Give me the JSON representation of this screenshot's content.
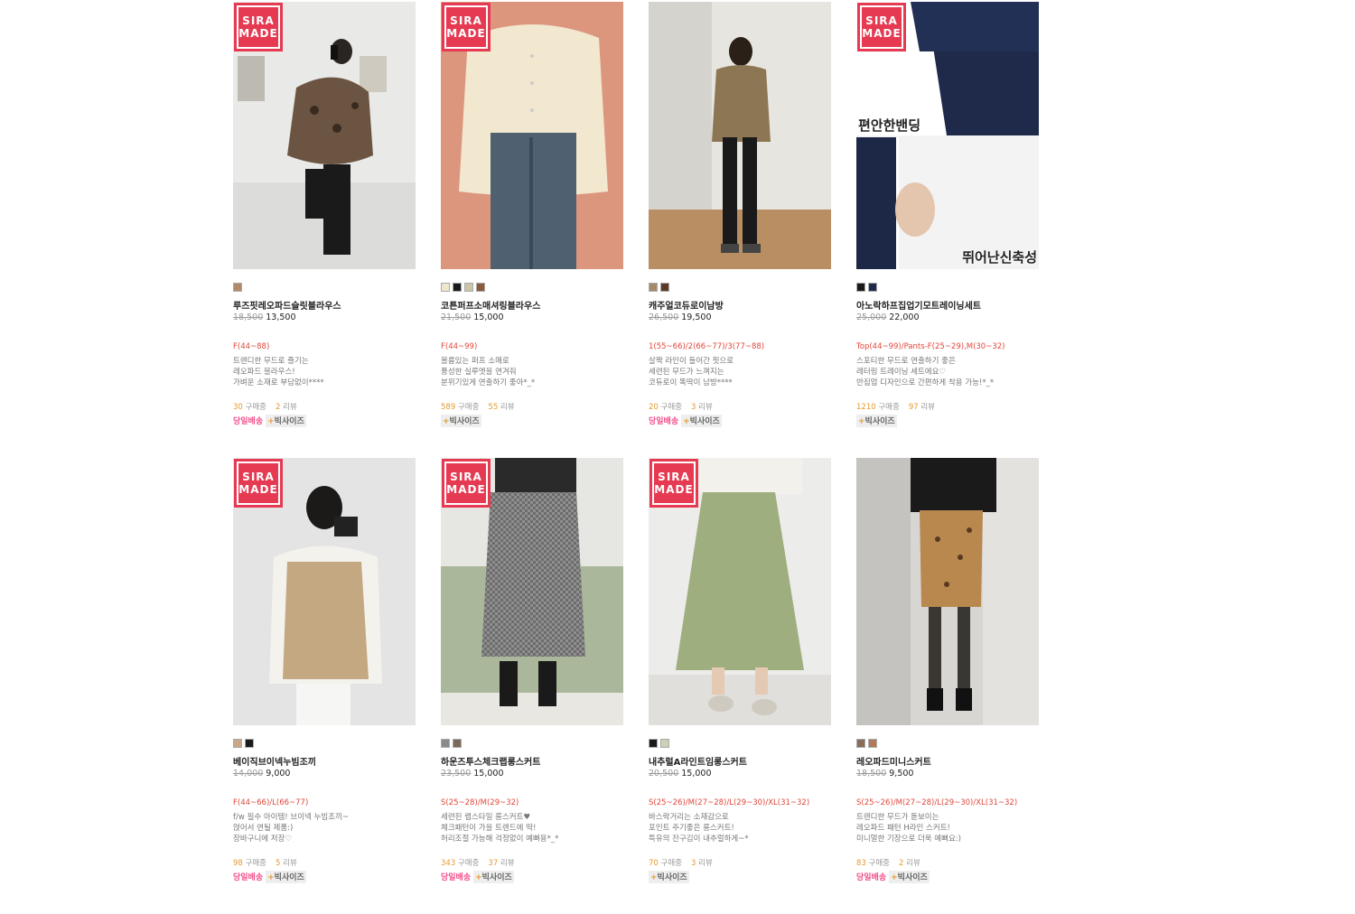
{
  "brand_badge": {
    "line1": "SIRA",
    "line2": "MADE"
  },
  "products": [
    {
      "name": "루즈핏레오파드슬릿블라우스",
      "original_price": "18,500",
      "price": "13,500",
      "sizes": "F(44~88)",
      "desc": [
        "트렌디한 무드로 즐기는",
        "레오파드 블라우스!",
        "가벼운 소재로 부담없이****"
      ],
      "purchases": "30",
      "purchases_label": "구매중",
      "reviews": "2",
      "reviews_label": "리뷰",
      "same_day": "당일배송",
      "big_size": "빅사이즈",
      "colors": [
        "#b08a6a"
      ],
      "has_badge": true,
      "overlay": []
    },
    {
      "name": "코튼퍼프소매셔링블라우스",
      "original_price": "21,500",
      "price": "15,000",
      "sizes": "F(44~99)",
      "desc": [
        "볼륨있는 퍼프 소매로",
        "풍성한 실루엣을 연겨줘",
        "분위기있게 연출하기 좋아*_*"
      ],
      "purchases": "589",
      "purchases_label": "구매중",
      "reviews": "55",
      "reviews_label": "리뷰",
      "same_day": "",
      "big_size": "빅사이즈",
      "colors": [
        "#efe6cf",
        "#1a1a1a",
        "#c9c7a8",
        "#8a5a3a"
      ],
      "has_badge": true,
      "overlay": []
    },
    {
      "name": "캐주얼코듀로이남방",
      "original_price": "26,500",
      "price": "19,500",
      "sizes": "1(55~66)/2(66~77)/3(77~88)",
      "desc": [
        "살짝 라인이 들어간 핏으로",
        "세련된 무드가 느껴지는",
        "코듀로이 똑딱이 남방****"
      ],
      "purchases": "20",
      "purchases_label": "구매중",
      "reviews": "3",
      "reviews_label": "리뷰",
      "same_day": "당일배송",
      "big_size": "빅사이즈",
      "colors": [
        "#a38a6b",
        "#5a3a24"
      ],
      "has_badge": false,
      "overlay": []
    },
    {
      "name": "아노락하프집업기모트레이닝세트",
      "original_price": "25,000",
      "price": "22,000",
      "sizes": "Top(44~99)/Pants-F(25~29),M(30~32)",
      "desc": [
        "스포티한 무드로 연출하기 좋은",
        "레터링 트레이닝 세트에요♡",
        "반집업 디자인으로 간편하게 착용 가능!*_*"
      ],
      "purchases": "1210",
      "purchases_label": "구매중",
      "reviews": "97",
      "reviews_label": "리뷰",
      "same_day": "",
      "big_size": "빅사이즈",
      "colors": [
        "#1a1a1a",
        "#1f2a4a"
      ],
      "has_badge": true,
      "overlay": [
        "편안한밴딩",
        "뛰어난신축성"
      ]
    },
    {
      "name": "베이직브이넥누빔조끼",
      "original_price": "14,000",
      "price": "9,000",
      "sizes": "F(44~66)/L(66~77)",
      "desc": [
        "f/w 필수 아이템! 브이넥 누빔조끼~",
        "얹어서 연될 제품:)",
        "장바구니에 저장♡"
      ],
      "purchases": "98",
      "purchases_label": "구매중",
      "reviews": "5",
      "reviews_label": "리뷰",
      "same_day": "당일배송",
      "big_size": "빅사이즈",
      "colors": [
        "#c8a887",
        "#1a1a1a"
      ],
      "has_badge": true,
      "overlay": []
    },
    {
      "name": "하운즈투스체크랩롱스커트",
      "original_price": "23,500",
      "price": "15,000",
      "sizes": "S(25~28)/M(29~32)",
      "desc": [
        "세련된 랩스타일 롱스커트♥",
        "체크패턴이 가을 트렌드에 딱!",
        "허리조절 가능해 걱정없이 예뻐용*_*"
      ],
      "purchases": "343",
      "purchases_label": "구매중",
      "reviews": "37",
      "reviews_label": "리뷰",
      "same_day": "당일배송",
      "big_size": "빅사이즈",
      "colors": [
        "#8a8a8a",
        "#7a6a5a"
      ],
      "has_badge": true,
      "overlay": []
    },
    {
      "name": "내추럴A라인트임롱스커트",
      "original_price": "20,500",
      "price": "15,000",
      "sizes": "S(25~26)/M(27~28)/L(29~30)/XL(31~32)",
      "desc": [
        "바스락거리는 소재감으로",
        "포인트 주기좋은 롱스커트!",
        "특유의 잔구김이 내추럴하게~*"
      ],
      "purchases": "70",
      "purchases_label": "구매중",
      "reviews": "3",
      "reviews_label": "리뷰",
      "same_day": "",
      "big_size": "빅사이즈",
      "colors": [
        "#1a1a1a",
        "#c9d2b2"
      ],
      "has_badge": true,
      "overlay": []
    },
    {
      "name": "레오파드미니스커트",
      "original_price": "18,500",
      "price": "9,500",
      "sizes": "S(25~26)/M(27~28)/L(29~30)/XL(31~32)",
      "desc": [
        "트렌디한 무드가 돋보이는",
        "레오파드 패턴 H라인 스커트!",
        "미니멀한 기장으로 더욱 예뻐요:)"
      ],
      "purchases": "83",
      "purchases_label": "구매중",
      "reviews": "2",
      "reviews_label": "리뷰",
      "same_day": "당일배송",
      "big_size": "빅사이즈",
      "colors": [
        "#8a6a5a",
        "#b07a5a"
      ],
      "has_badge": false,
      "overlay": []
    }
  ]
}
